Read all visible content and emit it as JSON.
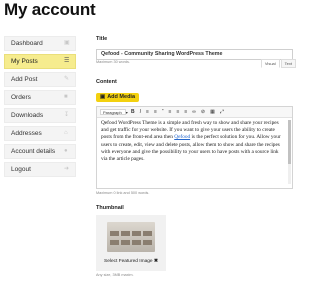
{
  "page_title": "My account",
  "sidebar": {
    "items": [
      {
        "label": "Dashboard",
        "icon": "dashboard-icon",
        "active": false
      },
      {
        "label": "My Posts",
        "icon": "list-icon",
        "active": true
      },
      {
        "label": "Add Post",
        "icon": "edit-icon",
        "active": false
      },
      {
        "label": "Orders",
        "icon": "cart-icon",
        "active": false
      },
      {
        "label": "Downloads",
        "icon": "download-icon",
        "active": false
      },
      {
        "label": "Addresses",
        "icon": "home-icon",
        "active": false
      },
      {
        "label": "Account details",
        "icon": "user-icon",
        "active": false
      },
      {
        "label": "Logout",
        "icon": "logout-icon",
        "active": false
      }
    ]
  },
  "form": {
    "title_label": "Title",
    "title_value": "Qefood - Community Sharing WordPress Theme",
    "title_hint": "Maximum 30 words.",
    "content_label": "Content",
    "add_media_label": "Add Media",
    "tab_visual": "Visual",
    "tab_text": "Text",
    "paragraph_select": "Paragraph",
    "content_text_before": "Qefood WordPress Theme is a simple and fresh way to show and share your recipes and get traffic for your website. If you want to give your users the ability to create posts from the front-end area then ",
    "content_link": "Qefood",
    "content_text_after": " is the perfect solution for you. Allow your users to create, edit, view and delete posts, allow them to show and share the recipes with everyone and give the possibility to your users to have posts with a source link via the article pages.",
    "content_hint": "Maximum 0 link and 500 words.",
    "thumbnail_label": "Thumbnail",
    "select_image_label": "Select Featured Image",
    "thumbnail_hint": "Any size, 3MB maxim."
  },
  "colors": {
    "accent": "#f3d10f",
    "active_item_bg": "#f6ec8e"
  }
}
